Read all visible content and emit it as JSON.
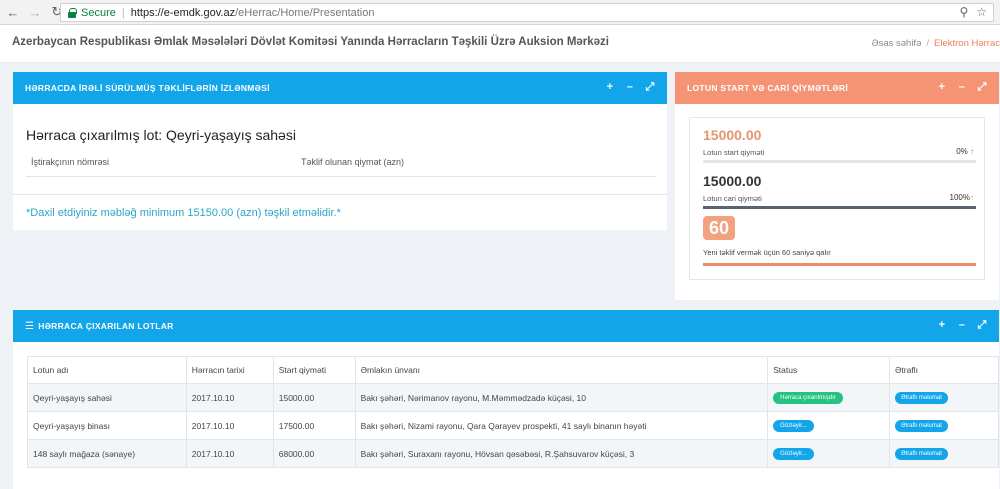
{
  "browser": {
    "secure_label": "Secure",
    "url_host": "https://e-emdk.gov.az",
    "url_path": "/eHerrac/Home/Presentation"
  },
  "header": {
    "title": "Azerbaycan Respublikası Əmlak Məsələləri Dövlət Komitəsi Yanında Hərracların Təşkili Üzrə Auksion Mərkəzi",
    "breadcrumb": [
      "Əsas səhifə",
      "Elektron Hərrac"
    ]
  },
  "bids_panel": {
    "title": "HƏRRACDA İRƏLİ SÜRÜLMÜŞ TƏKLİFLƏRİN İZLƏNMƏSİ",
    "lot_title": "Hərraca çıxarılmış lot: Qeyri-yaşayış sahəsi",
    "col_participant": "İştirakçının nömrəsi",
    "col_offer": "Təklif olunan qiymət (azn)",
    "notice": "*Daxil etdiyiniz məbləğ minimum 15150.00 (azn) təşkil etməlidir.*"
  },
  "price_panel": {
    "title": "LOTUN START VƏ CARİ QİYMƏTLƏRİ",
    "start_price": "15000.00",
    "start_label": "Lotun start qiyməti",
    "start_percent": "0%",
    "start_progress": 0,
    "current_price": "15000.00",
    "current_label": "Lotun cari qiyməti",
    "current_percent": "100%",
    "current_progress": 1,
    "countdown": "60",
    "countdown_label": "Yeni təklif vermək üçün 60 saniyə qalır",
    "countdown_progress": 1
  },
  "lots_panel": {
    "title": "HƏRRACA ÇIXARILAN LOTLAR",
    "columns": [
      "Lotun adı",
      "Hərracın tarixi",
      "Start qiyməti",
      "Əmlakın ünvanı",
      "Status",
      "Ətraflı"
    ],
    "rows": [
      {
        "name": "Qeyri-yaşayış sahəsi",
        "date": "2017.10.10",
        "price": "15000.00",
        "address": "Bakı şəhəri, Nərimanov rayonu, M.Məmmədzadə küçəsi, 10",
        "status": "Hərraca çıxarılmışdır",
        "detail": "Ətraflı məlumat"
      },
      {
        "name": "Qeyri-yaşayış binası",
        "date": "2017.10.10",
        "price": "17500.00",
        "address": "Bakı şəhəri, Nizami rayonu, Qara Qarayev prospekti, 41 saylı binanın həyəti",
        "status": "Gözləyir...",
        "detail": "Ətraflı məlumat"
      },
      {
        "name": "148 saylı mağaza (sənaye)",
        "date": "2017.10.10",
        "price": "68000.00",
        "address": "Bakı şəhəri, Suraxanı rayonu, Hövsan qəsəbəsi, R.Şahsuvarov küçəsi, 3",
        "status": "Gözləyir...",
        "detail": "Ətraflı məlumat"
      }
    ]
  },
  "colors": {
    "blue_header": "#12a5e9",
    "salmon_header": "#f59475",
    "accent_orange": "#e8956e",
    "status_green": "#26c281"
  },
  "icons": {
    "panel_tools": [
      "plus-icon",
      "minus-icon",
      "expand-icon"
    ],
    "list_icon": "list-icon"
  }
}
